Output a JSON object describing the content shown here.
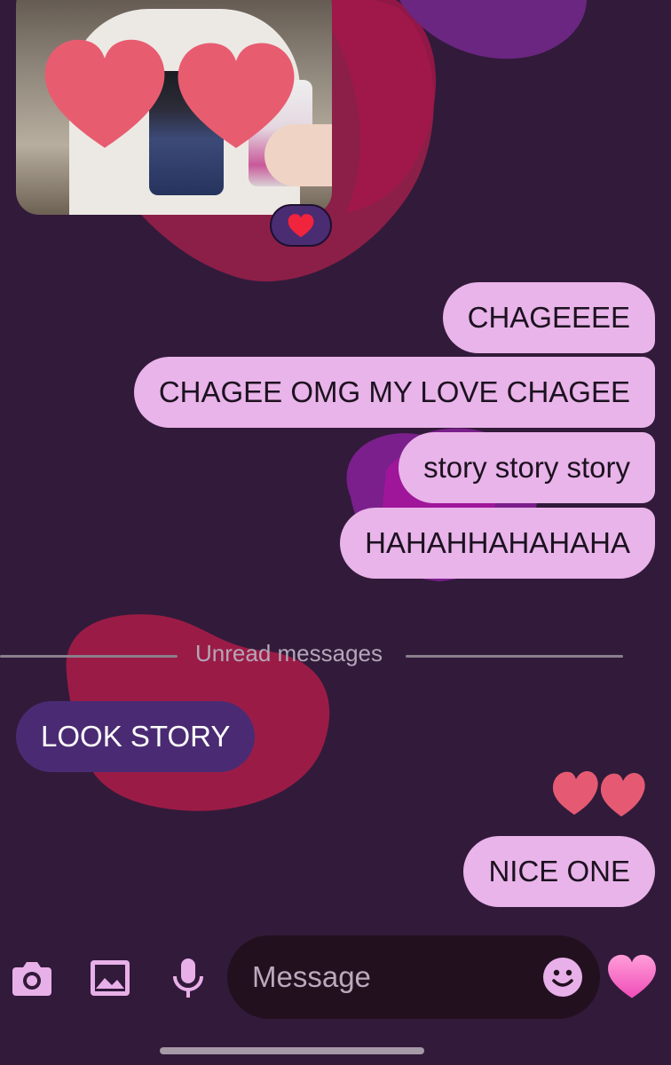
{
  "conversation": {
    "photo_reaction": "heart",
    "messages_sent_top": [
      {
        "text": "CHAGEEEE"
      },
      {
        "text": "CHAGEE OMG MY LOVE CHAGEE"
      },
      {
        "text": "story story story"
      },
      {
        "text": "HAHAHHAHAHAHA"
      }
    ],
    "unread_divider": "Unread messages",
    "message_received": {
      "text": "LOOK STORY"
    },
    "sticker": "two-hearts",
    "message_sent_last": {
      "text": "NICE ONE"
    }
  },
  "composer": {
    "placeholder": "Message",
    "camera_icon": "camera-icon",
    "gallery_icon": "image-icon",
    "mic_icon": "microphone-icon",
    "emoji_icon": "smiley-icon",
    "like_icon": "heart-icon"
  },
  "theme": {
    "background": "#321a3a",
    "sent_bubble": "#e9b4e9",
    "received_bubble": "#4a2b73",
    "heart_color": "#e55a72"
  }
}
